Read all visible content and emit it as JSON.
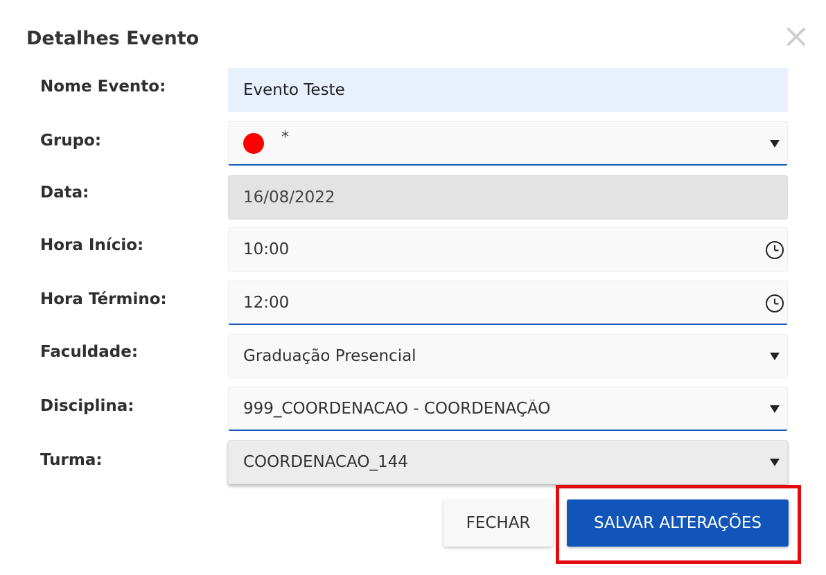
{
  "dialog": {
    "title": "Detalhes Evento",
    "close_icon": "close-icon"
  },
  "form": {
    "nome_evento": {
      "label": "Nome Evento:",
      "value": "Evento Teste"
    },
    "grupo": {
      "label": "Grupo:",
      "value": "*",
      "color": "#ff0000"
    },
    "data": {
      "label": "Data:",
      "value": "16/08/2022"
    },
    "hora_inicio": {
      "label": "Hora Início:",
      "value": "10:00",
      "icon": "clock-icon"
    },
    "hora_termino": {
      "label": "Hora Término:",
      "value": "12:00",
      "icon": "clock-icon"
    },
    "faculdade": {
      "label": "Faculdade:",
      "value": "Graduação Presencial"
    },
    "disciplina": {
      "label": "Disciplina:",
      "value": "999_COORDENACAO - COORDENAÇÃO"
    },
    "turma": {
      "label": "Turma:",
      "value": "COORDENACAO_144"
    }
  },
  "buttons": {
    "close_label": "FECHAR",
    "save_label": "SALVAR ALTERAÇÕES"
  },
  "colors": {
    "primary": "#1155b9",
    "highlight": "#e30b10",
    "input_focus_underline": "#1a5ab8"
  }
}
